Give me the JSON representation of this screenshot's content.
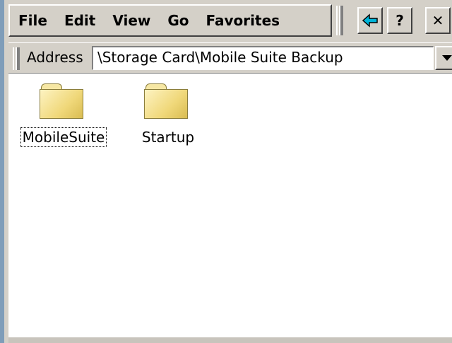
{
  "menu": {
    "items": [
      "File",
      "Edit",
      "View",
      "Go",
      "Favorites"
    ]
  },
  "toolbar": {
    "back_icon": "back-arrow-icon",
    "help_label": "?",
    "close_label": "✕"
  },
  "address": {
    "label": "Address",
    "value": "\\Storage Card\\Mobile Suite Backup"
  },
  "files": [
    {
      "name": "MobileSuite",
      "type": "folder",
      "selected": true
    },
    {
      "name": "Startup",
      "type": "folder",
      "selected": false
    }
  ],
  "colors": {
    "chrome": "#d4d0c8",
    "folder": "#f0d87a",
    "frame": "#7f9db9",
    "back_arrow": "#00b4d8"
  }
}
